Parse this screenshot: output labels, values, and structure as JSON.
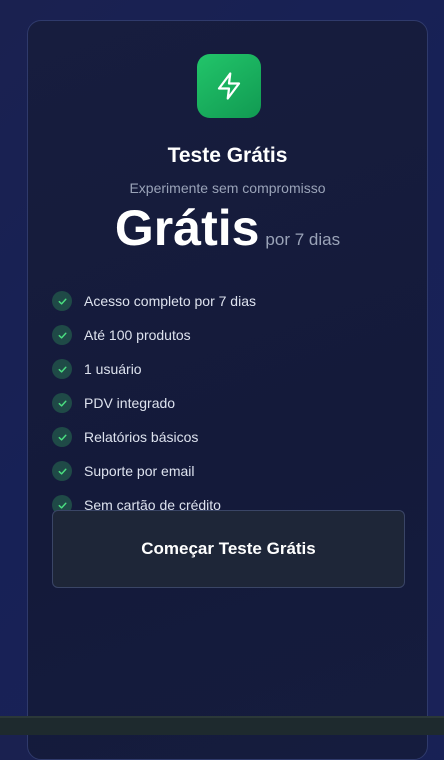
{
  "plan": {
    "icon": "lightning-bolt-icon",
    "title": "Teste Grátis",
    "subtitle": "Experimente sem compromisso",
    "price": "Grátis",
    "period": "por 7 dias"
  },
  "features": [
    {
      "icon": "check-icon",
      "label": "Acesso completo por 7 dias"
    },
    {
      "icon": "check-icon",
      "label": "Até 100 produtos"
    },
    {
      "icon": "check-icon",
      "label": "1 usuário"
    },
    {
      "icon": "check-icon",
      "label": "PDV integrado"
    },
    {
      "icon": "check-icon",
      "label": "Relatórios básicos"
    },
    {
      "icon": "check-icon",
      "label": "Suporte por email"
    },
    {
      "icon": "check-icon",
      "label": "Sem cartão de crédito"
    }
  ],
  "cta": {
    "label": "Começar Teste Grátis"
  },
  "colors": {
    "accent_green": "#22c56a",
    "check_bg": "#1f4a47",
    "check_mark": "#4ade80",
    "background": "#1a2150",
    "card": "#161c3c",
    "button_bg": "#1e2638"
  }
}
